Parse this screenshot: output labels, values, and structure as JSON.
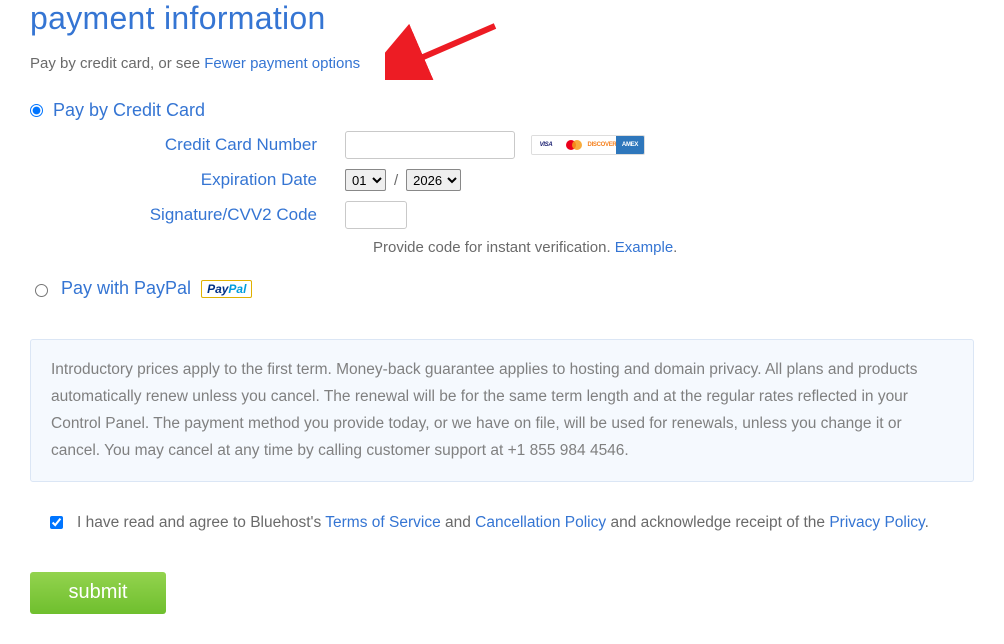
{
  "title": "payment information",
  "intro": {
    "prefix": "Pay by credit card, or see ",
    "link": "Fewer payment options"
  },
  "cc": {
    "option_label": "Pay by Credit Card",
    "number_label": "Credit Card Number",
    "number_value": "",
    "exp_label": "Expiration Date",
    "exp_month": "01",
    "exp_year": "2026",
    "exp_separator": "/",
    "cvv_label": "Signature/CVV2 Code",
    "cvv_value": "",
    "hint_text": "Provide code for instant verification. ",
    "hint_link": "Example",
    "hint_period": ".",
    "brands": {
      "visa": "VISA",
      "discover": "DISCOVER",
      "amex": "AMEX"
    }
  },
  "paypal": {
    "option_label": "Pay with PayPal",
    "badge_left": "Pay",
    "badge_right": "Pal"
  },
  "fine_print": "Introductory prices apply to the first term. Money-back guarantee applies to hosting and domain privacy. All plans and products automatically renew unless you cancel. The renewal will be for the same term length and at the regular rates reflected in your Control Panel. The payment method you provide today, or we have on file, will be used for renewals, unless you change it or cancel. You may cancel at any time by calling customer support at +1 855 984 4546.",
  "agree": {
    "checked": true,
    "pre": "I have read and agree to Bluehost's ",
    "tos": "Terms of Service",
    "mid1": " and ",
    "cancel": "Cancellation Policy",
    "mid2": " and acknowledge receipt of the ",
    "privacy": "Privacy Policy",
    "post": "."
  },
  "submit_label": "submit"
}
